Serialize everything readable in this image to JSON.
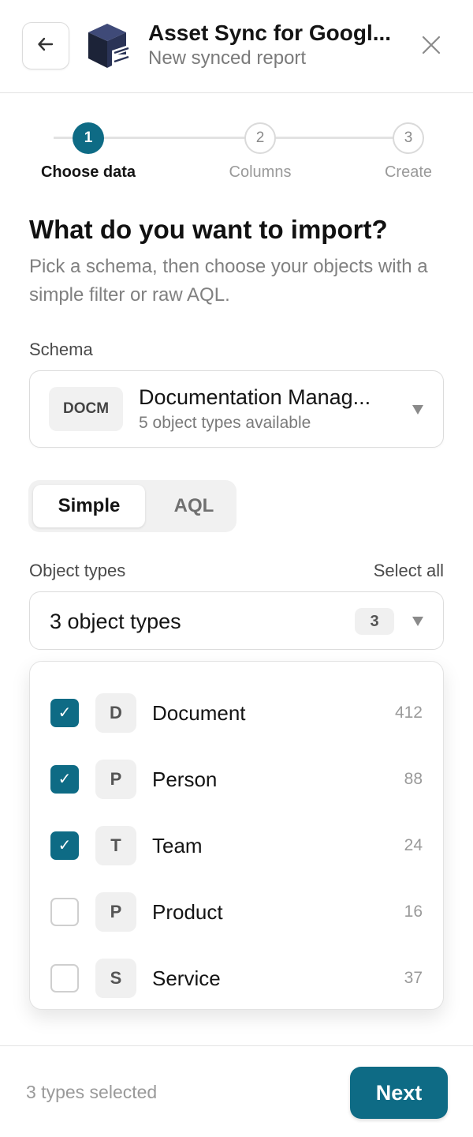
{
  "header": {
    "title": "Asset Sync for Googl...",
    "subtitle": "New synced report",
    "back_icon": "arrow-left-icon",
    "close_icon": "close-icon",
    "logo_icon": "cube-logo-icon"
  },
  "stepper": {
    "current_step": 1,
    "steps": [
      {
        "number": "1",
        "label": "Choose data",
        "state": "active"
      },
      {
        "number": "2",
        "label": "Columns",
        "state": "upcoming"
      },
      {
        "number": "3",
        "label": "Create",
        "state": "upcoming"
      }
    ]
  },
  "main": {
    "title": "What do you want to import?",
    "description": "Pick a schema, then choose your objects with a simple filter or raw AQL."
  },
  "schema": {
    "label": "Schema",
    "key": "DOCM",
    "name": "Documentation Manag...",
    "count_text": "5 object types available"
  },
  "mode": {
    "options": [
      "Simple",
      "AQL"
    ],
    "selected": "Simple"
  },
  "object_types": {
    "label": "Object types",
    "select_all": "Select all",
    "summary": "3 object types",
    "badge": "3",
    "items": [
      {
        "letter": "D",
        "name": "Document",
        "count": "412",
        "checked": true
      },
      {
        "letter": "P",
        "name": "Person",
        "count": "88",
        "checked": true
      },
      {
        "letter": "T",
        "name": "Team",
        "count": "24",
        "checked": true
      },
      {
        "letter": "P",
        "name": "Product",
        "count": "16",
        "checked": false
      },
      {
        "letter": "S",
        "name": "Service",
        "count": "37",
        "checked": false
      }
    ]
  },
  "footer": {
    "status": "3 types selected",
    "next_label": "Next"
  },
  "colors": {
    "accent": "#0e6b85",
    "text": "#141414",
    "muted": "#808080",
    "border": "#dcdcdc"
  }
}
